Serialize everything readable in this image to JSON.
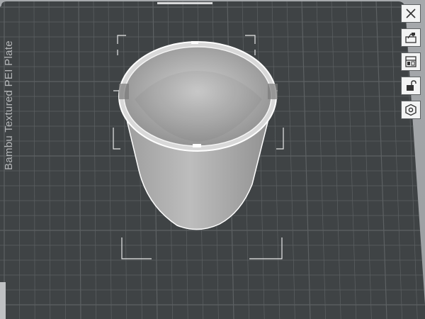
{
  "plate": {
    "label": "Bambu Textured PEI Plate",
    "surface_color": "#3f4345",
    "grid_color": "#5d6163"
  },
  "model": {
    "description_icon": "cup-model-icon",
    "color": "#bdbdbd"
  },
  "toolbar": {
    "buttons": [
      {
        "name": "close",
        "icon": "close-icon"
      },
      {
        "name": "auto-orient",
        "icon": "auto-orient-icon"
      },
      {
        "name": "arrange",
        "icon": "arrange-icon"
      },
      {
        "name": "lock",
        "icon": "lock-icon"
      },
      {
        "name": "settings",
        "icon": "hexagon-settings-icon"
      }
    ]
  }
}
